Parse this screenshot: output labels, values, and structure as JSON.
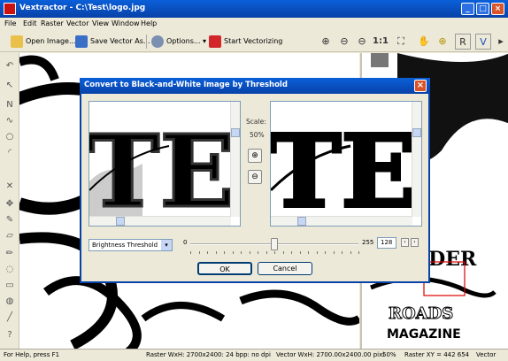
{
  "window": {
    "title": "Vextractor - C:\\Test\\logo.jpg",
    "buttons": {
      "minimize": "_",
      "maximize": "□",
      "close": "×"
    }
  },
  "menu": [
    "File",
    "Edit",
    "Raster",
    "Vector",
    "View",
    "Window",
    "Help"
  ],
  "toolbar": {
    "open_image": "Open Image...",
    "save_vector": "Save Vector As...",
    "options": "Options...",
    "start_vectorizing": "Start Vectorizing",
    "zoom_ratio": "1:1"
  },
  "dialog": {
    "title": "Convert to Black-and-White Image by Threshold",
    "scale_label": "Scale:",
    "scale_value": "50%",
    "method": "Brightness Threshold",
    "slider_min": "0",
    "slider_max": "255",
    "threshold_value": "128",
    "threshold_fraction": 0.5,
    "ok": "OK",
    "cancel": "Cancel"
  },
  "status": {
    "help": "For Help, press F1",
    "raster_info": "Raster WxH: 2700x2400: 24 bpp: no dpi",
    "vector_info": "Vector WxH: 2700.00x2400.00 pixi",
    "zoom": "50%",
    "raster_xy": "Raster XY = 442  654",
    "mode": "Vector"
  },
  "colors": {
    "titlebar": "#0842a8",
    "accent_red": "#c11111",
    "close_button": "#d8552b"
  }
}
